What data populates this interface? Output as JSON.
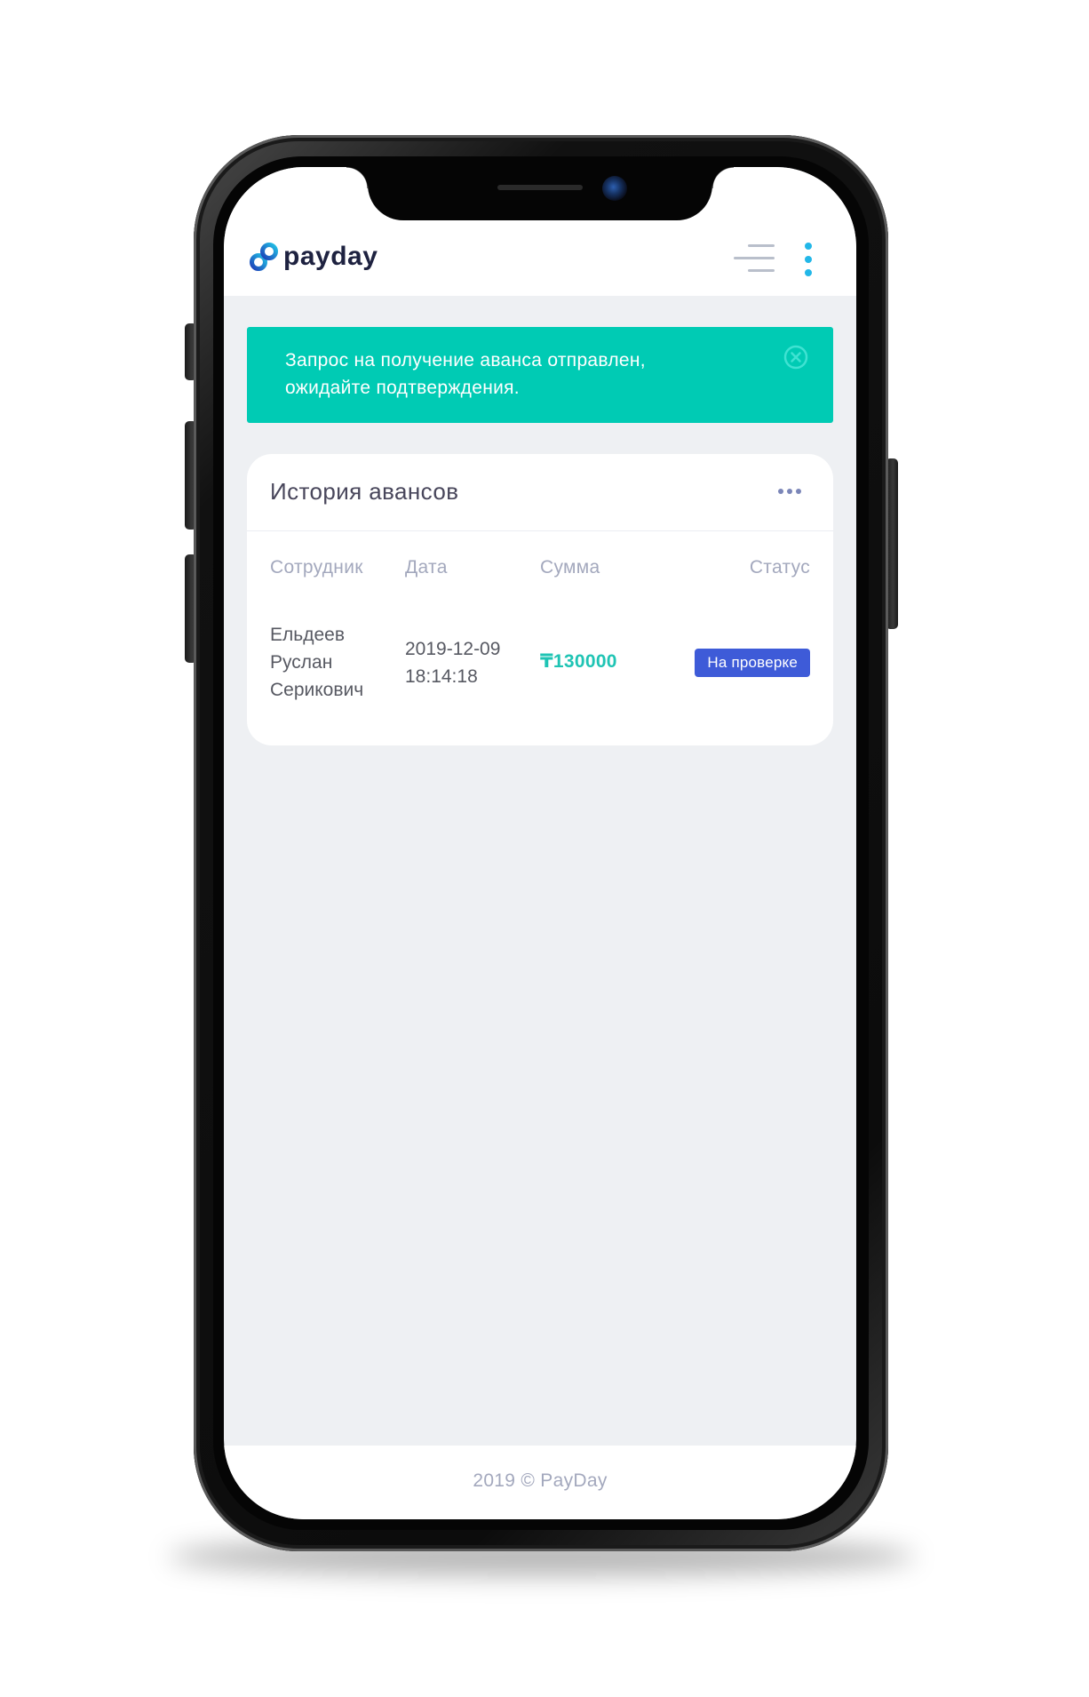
{
  "header": {
    "logo_text": "payday",
    "menu_icon": "hamburger-menu-icon",
    "more_icon": "vertical-dots-icon",
    "accent_color": "#22b7e8"
  },
  "alert": {
    "message_line1": "Запрос на получение аванса отправлен,",
    "message_line2": "ожидайте подтверждения.",
    "close_icon": "close-circle-icon",
    "background_color": "#00cbb4"
  },
  "advance_history": {
    "title": "История авансов",
    "columns": [
      "Сотрудник",
      "Дата",
      "Сумма",
      "Статус"
    ],
    "rows": [
      {
        "employee_line1": "Ельдеев",
        "employee_line2": "Руслан",
        "employee_line3": "Серикович",
        "date": "2019-12-09",
        "time": "18:14:18",
        "amount": "₸130000",
        "status": "На проверке"
      }
    ]
  },
  "footer": {
    "text": "2019 © PayDay"
  }
}
